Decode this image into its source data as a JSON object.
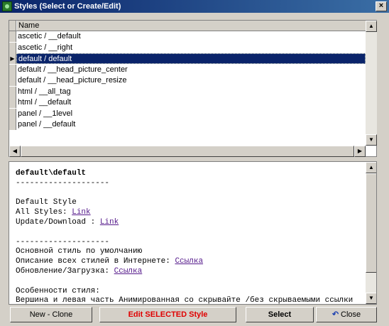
{
  "window": {
    "title": "Styles (Select or Create/Edit)",
    "close_glyph": "×",
    "icon": "app-icon"
  },
  "grid": {
    "column_header": "Name",
    "selected_index": 2,
    "rows": [
      "ascetic / __default",
      "ascetic / __right",
      "default / default",
      "default / __head_picture_center",
      "default / __head_picture_resize",
      "html / __all_tag",
      "html / __default",
      "panel / __1level",
      "panel / __default"
    ]
  },
  "detail": {
    "heading": "default\\default",
    "sep1": "--------------------",
    "l1": "Default Style",
    "l2_label": "All Styles: ",
    "l2_link": "Link",
    "l3_label": "Update/Download : ",
    "l3_link": "Link",
    "sep2": "--------------------",
    "r1": "Основной стиль по умолчанию",
    "r2_label": "Описание всех стилей в Интернете: ",
    "r2_link": "Ссылка",
    "r3_label": "Обновление/Загрузка: ",
    "r3_link": "Ссылка",
    "r4": "Особенности стиля:",
    "r5": "Вершина и левая часть Анимированная со скрывайте /без скрываемыми ссылки"
  },
  "buttons": {
    "new_clone": "New - Clone",
    "edit": "Edit SELECTED Style",
    "select": "Select",
    "close": "Close"
  }
}
